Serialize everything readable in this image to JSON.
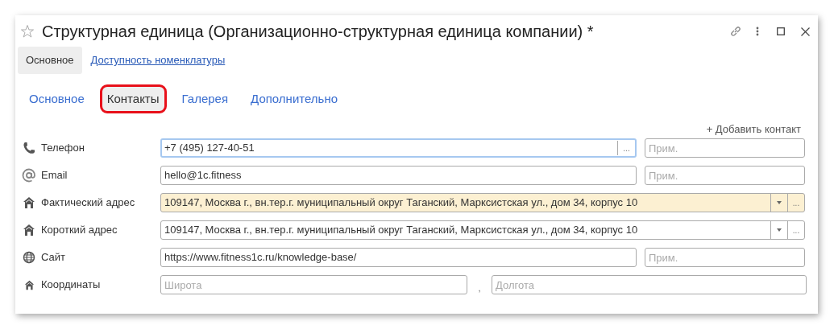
{
  "window": {
    "title": "Структурная единица (Организационно-структурная единица компании) *",
    "favorite": false
  },
  "top_tabs": [
    {
      "label": "Основное",
      "selected": true,
      "kind": "tab"
    },
    {
      "label": "Доступность номенклатуры",
      "selected": false,
      "kind": "link"
    }
  ],
  "tabs": [
    {
      "label": "Основное",
      "selected": false
    },
    {
      "label": "Контакты",
      "selected": true
    },
    {
      "label": "Галерея",
      "selected": false
    },
    {
      "label": "Дополнительно",
      "selected": false
    }
  ],
  "add_contact": "+ Добавить контакт",
  "rows": [
    {
      "label": "Телефон",
      "kind": "picker",
      "value": "+7 (495) 127-40-51",
      "ellipsis": "...",
      "note_placeholder": "Прим.",
      "focused": true,
      "highlighted": false
    },
    {
      "label": "Email",
      "kind": "text",
      "value": "hello@1c.fitness",
      "note_placeholder": "Прим.",
      "focused": false,
      "highlighted": false
    },
    {
      "label": "Фактический адрес",
      "kind": "address",
      "value": "109147, Москва г., вн.тер.г. муниципальный округ Таганский, Марксистская ул., дом 34, корпус 10",
      "ellipsis": "...",
      "focused": false,
      "highlighted": true
    },
    {
      "label": "Короткий адрес",
      "kind": "address",
      "value": "109147, Москва г., вн.тер.г. муниципальный округ Таганский, Марксистская ул., дом 34, корпус 10",
      "ellipsis": "...",
      "focused": false,
      "highlighted": false
    },
    {
      "label": "Сайт",
      "kind": "text",
      "value": "https://www.fitness1c.ru/knowledge-base/",
      "note_placeholder": "Прим.",
      "focused": false,
      "highlighted": false
    },
    {
      "label": "Координаты",
      "kind": "coordinates",
      "lat_placeholder": "Широта",
      "separator": ",",
      "lon_placeholder": "Долгота",
      "focused": false,
      "highlighted": false
    }
  ]
}
